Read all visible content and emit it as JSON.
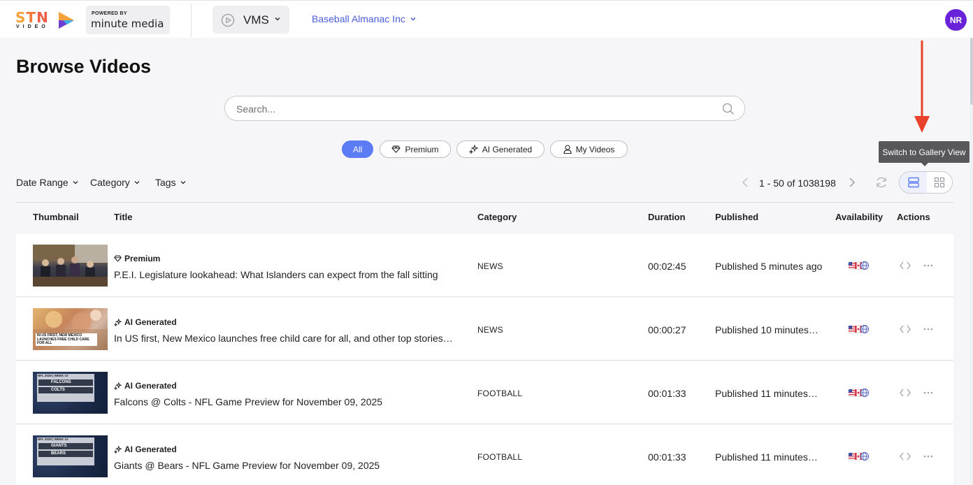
{
  "brand": {
    "stn_letters": [
      "S",
      "T",
      "N"
    ],
    "stn_sub": "VIDEO",
    "powered_by": "POWERED BY",
    "partner": "minute media"
  },
  "header": {
    "app_label": "VMS",
    "org_label": "Baseball Almanac Inc",
    "avatar_initials": "NR"
  },
  "page": {
    "title": "Browse Videos"
  },
  "search": {
    "placeholder": "Search..."
  },
  "filter_chips": [
    {
      "label": "All",
      "active": true,
      "icon": null
    },
    {
      "label": "Premium",
      "active": false,
      "icon": "diamond-icon"
    },
    {
      "label": "AI Generated",
      "active": false,
      "icon": "sparkle-icon"
    },
    {
      "label": "My Videos",
      "active": false,
      "icon": "user-icon"
    }
  ],
  "dropdowns": {
    "date_range": "Date Range",
    "category": "Category",
    "tags": "Tags"
  },
  "pagination": {
    "range_text": "1 - 50 of 1038198"
  },
  "view_toggle": {
    "tooltip": "Switch to Gallery View",
    "current": "list"
  },
  "table": {
    "columns": {
      "thumbnail": "Thumbnail",
      "title": "Title",
      "category": "Category",
      "duration": "Duration",
      "published": "Published",
      "availability": "Availability",
      "actions": "Actions"
    },
    "rows": [
      {
        "badge": "Premium",
        "badge_icon": "diamond-icon",
        "title": "P.E.I. Legislature lookahead: What Islanders can expect from the fall sitting",
        "category": "NEWS",
        "duration": "00:02:45",
        "published": "Published 5 minutes ago"
      },
      {
        "badge": "AI Generated",
        "badge_icon": "sparkle-icon",
        "title": "In US first, New Mexico launches free child care for all, and other top stories…",
        "category": "NEWS",
        "duration": "00:00:27",
        "published": "Published 10 minutes…",
        "thumb_caption": "IN US FIRST, NEW MEXICO LAUNCHES FREE CHILD CARE FOR ALL"
      },
      {
        "badge": "AI Generated",
        "badge_icon": "sparkle-icon",
        "title": "Falcons @ Colts - NFL Game Preview for November 09, 2025",
        "category": "FOOTBALL",
        "duration": "00:01:33",
        "published": "Published 11 minutes…",
        "thumb_header": "NFL 2025 | WEEK 10",
        "thumb_team1": "FALCONS",
        "thumb_team2": "COLTS"
      },
      {
        "badge": "AI Generated",
        "badge_icon": "sparkle-icon",
        "title": "Giants @ Bears - NFL Game Preview for November 09, 2025",
        "category": "FOOTBALL",
        "duration": "00:01:33",
        "published": "Published 11 minutes…",
        "thumb_header": "NFL 2025 | WEEK 10",
        "thumb_team1": "GIANTS",
        "thumb_team2": "BEARS"
      }
    ]
  },
  "colors": {
    "accent": "#5b7cf5",
    "avatar": "#6a22d9",
    "org_link": "#4b5ed8",
    "annotation_arrow": "#e8412c"
  }
}
